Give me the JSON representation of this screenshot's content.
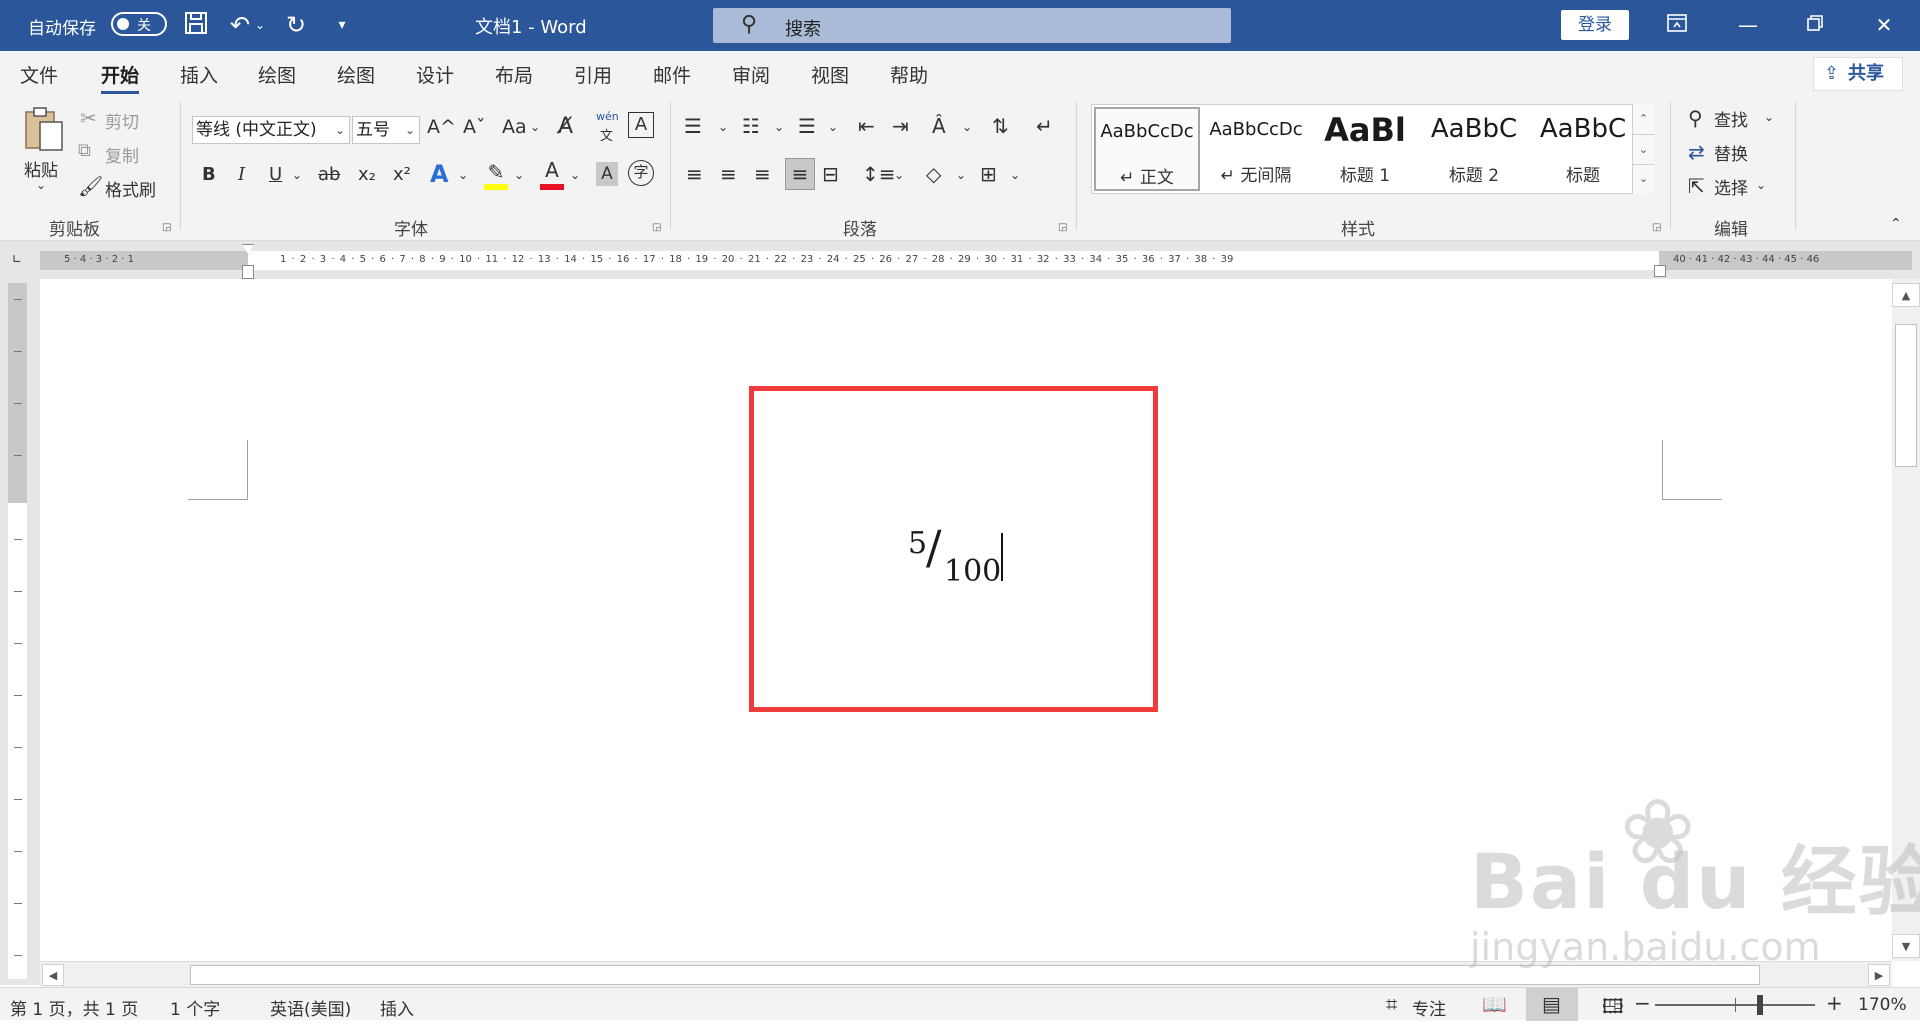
{
  "titlebar": {
    "autosave_label": "自动保存",
    "autosave_state": "关",
    "doc_title": "文档1  -  Word",
    "search_placeholder": "搜索",
    "login": "登录"
  },
  "tabs": [
    {
      "label": "文件"
    },
    {
      "label": "开始",
      "active": true
    },
    {
      "label": "插入"
    },
    {
      "label": "绘图"
    },
    {
      "label": "绘图"
    },
    {
      "label": "设计"
    },
    {
      "label": "布局"
    },
    {
      "label": "引用"
    },
    {
      "label": "邮件"
    },
    {
      "label": "审阅"
    },
    {
      "label": "视图"
    },
    {
      "label": "帮助"
    }
  ],
  "share_label": "共享",
  "ribbon": {
    "clipboard": {
      "label": "剪贴板",
      "paste": "粘贴",
      "cut": "剪切",
      "copy": "复制",
      "format_painter": "格式刷"
    },
    "font": {
      "label": "字体",
      "font_name": "等线 (中文正文)",
      "font_size": "五号",
      "grow_font": "A^",
      "shrink_font": "Aˇ",
      "change_case": "Aa",
      "phonetic_top": "wén",
      "phonetic_bottom": "文",
      "bold": "B",
      "italic": "I",
      "underline": "U",
      "strike": "ab",
      "subscript": "x₂",
      "superscript": "x²",
      "text_effect": "A",
      "font_color": "A",
      "char_shading": "A",
      "enclose": "字"
    },
    "paragraph": {
      "label": "段落"
    },
    "styles": {
      "label": "样式",
      "items": [
        {
          "sample": "AaBbCcDc",
          "name": "↵ 正文"
        },
        {
          "sample": "AaBbCcDc",
          "name": "↵ 无间隔"
        },
        {
          "sample": "AaBl",
          "name": "标题 1"
        },
        {
          "sample": "AaBbC",
          "name": "标题 2"
        },
        {
          "sample": "AaBbC",
          "name": "标题"
        }
      ]
    },
    "editing": {
      "label": "编辑",
      "find": "查找",
      "replace": "替换",
      "select": "选择"
    }
  },
  "ruler": {
    "left_numbers": "5 · 4 · 3 · 2 · 1",
    "numbers": "1 · 2 · 3 · 4 · 5 · 6 · 7 · 8 · 9 · 10 · 11 · 12 · 13 · 14 · 15 · 16 · 17 · 18 · 19 · 20 · 21 · 22 · 23 · 24 · 25 · 26 · 27 · 28 · 29 · 30 · 31 · 32 · 33 · 34 · 35 · 36 · 37 · 38 · 39",
    "right_numbers": "40 · 41 · 42 · 43 · 44 · 45 · 46"
  },
  "document": {
    "equation": {
      "numerator": "5",
      "slash": "/",
      "denominator": "100"
    }
  },
  "status": {
    "page": "第 1 页，共 1 页",
    "words": "1 个字",
    "language": "英语(美国)",
    "mode": "插入",
    "focus": "专注",
    "zoom_minus": "−",
    "zoom_plus": "+",
    "zoom": "170%"
  },
  "watermark": {
    "brand": "Bai du 经验",
    "url": "jingyan.baidu.com"
  }
}
